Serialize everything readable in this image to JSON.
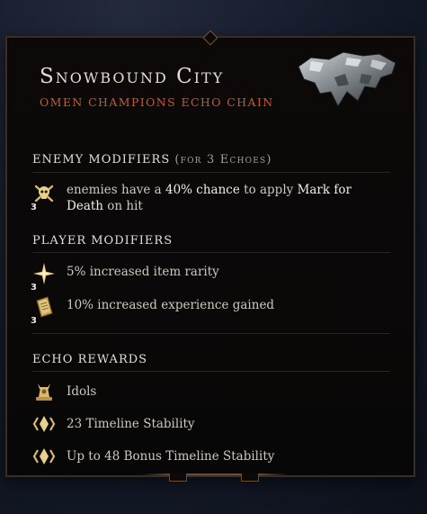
{
  "header": {
    "title": "Snowbound City",
    "subtitle": "Omen Champions Echo Chain"
  },
  "enemy_modifiers": {
    "heading": "Enemy Modifiers",
    "heading_note": "(for 3 Echoes)",
    "items": [
      {
        "icon": "skull-crossbones-icon",
        "stack": "3",
        "text_before": "enemies have a ",
        "highlight1": "40% chance",
        "text_middle": " to apply ",
        "highlight2": "Mark for Death",
        "text_after": " on hit"
      }
    ]
  },
  "player_modifiers": {
    "heading": "Player Modifiers",
    "items": [
      {
        "icon": "sparkle-star-icon",
        "stack": "3",
        "text": "5% increased item rarity"
      },
      {
        "icon": "tome-icon",
        "stack": "3",
        "text": "10% increased experience gained"
      }
    ]
  },
  "echo_rewards": {
    "heading": "Echo Rewards",
    "items": [
      {
        "icon": "idol-icon",
        "text": "Idols"
      },
      {
        "icon": "timeline-stability-icon",
        "text": "23 Timeline Stability"
      },
      {
        "icon": "timeline-stability-icon",
        "text": "Up to 48 Bonus Timeline Stability"
      }
    ]
  },
  "colors": {
    "title": "#e4ddd4",
    "subtitle": "#c8592f",
    "text": "#cfc8be",
    "icon_gold": "#d9b870"
  }
}
